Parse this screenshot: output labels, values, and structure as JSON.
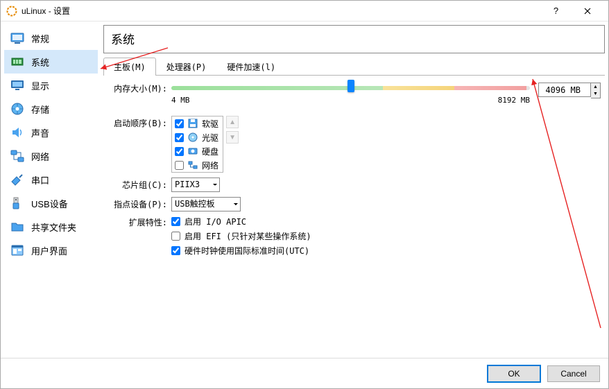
{
  "window": {
    "title": "uLinux - 设置"
  },
  "sidebar": {
    "items": [
      {
        "label": "常规"
      },
      {
        "label": "系统"
      },
      {
        "label": "显示"
      },
      {
        "label": "存储"
      },
      {
        "label": "声音"
      },
      {
        "label": "网络"
      },
      {
        "label": "串口"
      },
      {
        "label": "USB设备"
      },
      {
        "label": "共享文件夹"
      },
      {
        "label": "用户界面"
      }
    ],
    "active_index": 1
  },
  "main": {
    "title": "系统",
    "tabs": [
      {
        "label": "主板(M)"
      },
      {
        "label": "处理器(P)"
      },
      {
        "label": "硬件加速(l)"
      }
    ],
    "active_tab": 0
  },
  "memory": {
    "label": "内存大小(M):",
    "min_label": "4 MB",
    "max_label": "8192 MB",
    "value_display": "4096 MB",
    "percent": 50
  },
  "boot": {
    "label": "启动顺序(B):",
    "items": [
      {
        "label": "软驱",
        "checked": true
      },
      {
        "label": "光驱",
        "checked": true
      },
      {
        "label": "硬盘",
        "checked": true
      },
      {
        "label": "网络",
        "checked": false
      }
    ]
  },
  "chipset": {
    "label": "芯片组(C):",
    "value": "PIIX3"
  },
  "pointing": {
    "label": "指点设备(P):",
    "value": "USB触控板"
  },
  "ext": {
    "label": "扩展特性:",
    "ioapic": {
      "label": "启用 I/O APIC",
      "checked": true
    },
    "efi": {
      "label": "启用 EFI (只针对某些操作系统)",
      "checked": false
    },
    "utc": {
      "label": "硬件时钟使用国际标准时间(UTC)",
      "checked": true
    }
  },
  "footer": {
    "ok": "OK",
    "cancel": "Cancel"
  }
}
